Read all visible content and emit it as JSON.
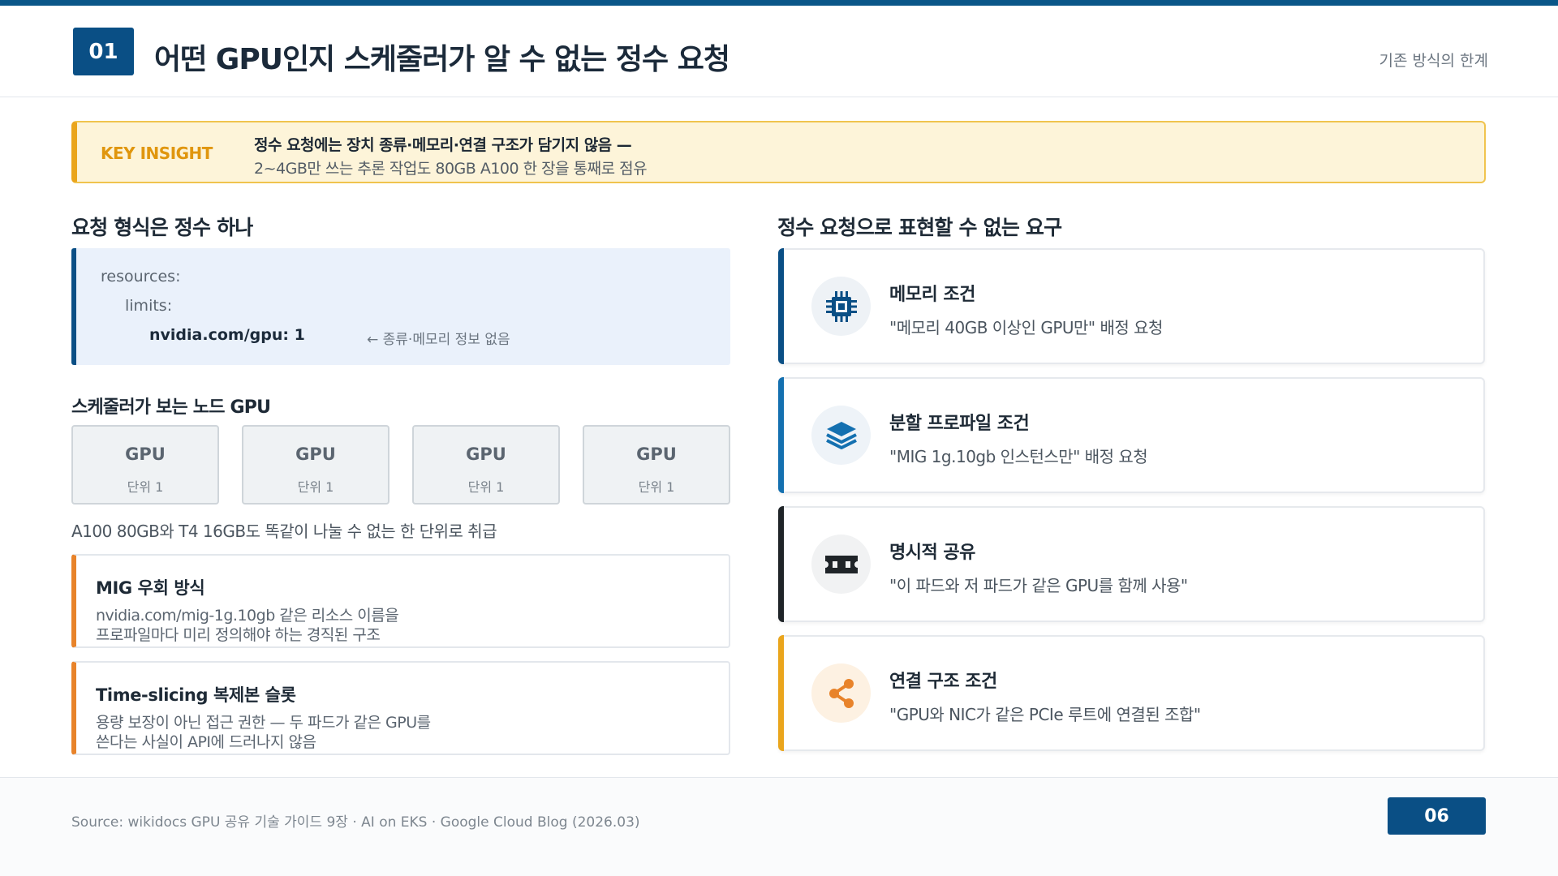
{
  "header": {
    "number": "01",
    "title": "어떤 GPU인지 스케줄러가 알 수 없는 정수 요청",
    "section": "기존 방식의 한계"
  },
  "insight": {
    "label": "KEY INSIGHT",
    "line1": "정수 요청에는 장치 종류·메모리·연결 구조가 담기지 않음 —",
    "line2": "2~4GB만 쓰는 추론 작업도 80GB A100 한 장을 통째로 점유"
  },
  "left": {
    "heading": "요청 형식은 정수 하나",
    "code": {
      "line1": "resources:",
      "line2": "limits:",
      "line3": "nvidia.com/gpu: 1",
      "note": "← 종류·메모리 정보 없음"
    },
    "gpu_heading": "스케줄러가 보는 노드 GPU",
    "gpus": [
      {
        "name": "GPU",
        "unit": "단위 1"
      },
      {
        "name": "GPU",
        "unit": "단위 1"
      },
      {
        "name": "GPU",
        "unit": "단위 1"
      },
      {
        "name": "GPU",
        "unit": "단위 1"
      }
    ],
    "gpu_caption": "A100 80GB와 T4 16GB도 똑같이 나눌 수 없는 한 단위로 취급",
    "workarounds": [
      {
        "title": "MIG 우회 방식",
        "line1": "nvidia.com/mig-1g.10gb 같은 리소스 이름을",
        "line2": "프로파일마다 미리 정의해야 하는 경직된 구조"
      },
      {
        "title": "Time-slicing 복제본 슬롯",
        "line1": "용량 보장이 아닌 접근 권한 — 두 파드가 같은 GPU를",
        "line2": "쓴다는 사실이 API에 드러나지 않음"
      }
    ]
  },
  "right": {
    "heading": "정수 요청으로 표현할 수 없는 요구",
    "requirements": [
      {
        "icon": "chip-icon",
        "title": "메모리 조건",
        "desc": "\"메모리 40GB 이상인 GPU만\" 배정 요청",
        "accent": "#0a4f85"
      },
      {
        "icon": "layers-icon",
        "title": "분할 프로파일 조건",
        "desc": "\"MIG 1g.10gb 인스턴스만\" 배정 요청",
        "accent": "#1470b0"
      },
      {
        "icon": "ticket-icon",
        "title": "명시적 공유",
        "desc": "\"이 파드와 저 파드가 같은 GPU를 함께 사용\"",
        "accent": "#1f2428"
      },
      {
        "icon": "share-icon",
        "title": "연결 구조 조건",
        "desc": "\"GPU와 NIC가 같은 PCIe 루트에 연결된 조합\"",
        "accent": "#eaa51c"
      }
    ]
  },
  "footer": {
    "source": "Source: wikidocs GPU 공유 기술 가이드 9장 · AI on EKS · Google Cloud Blog (2026.03)",
    "page": "06"
  }
}
